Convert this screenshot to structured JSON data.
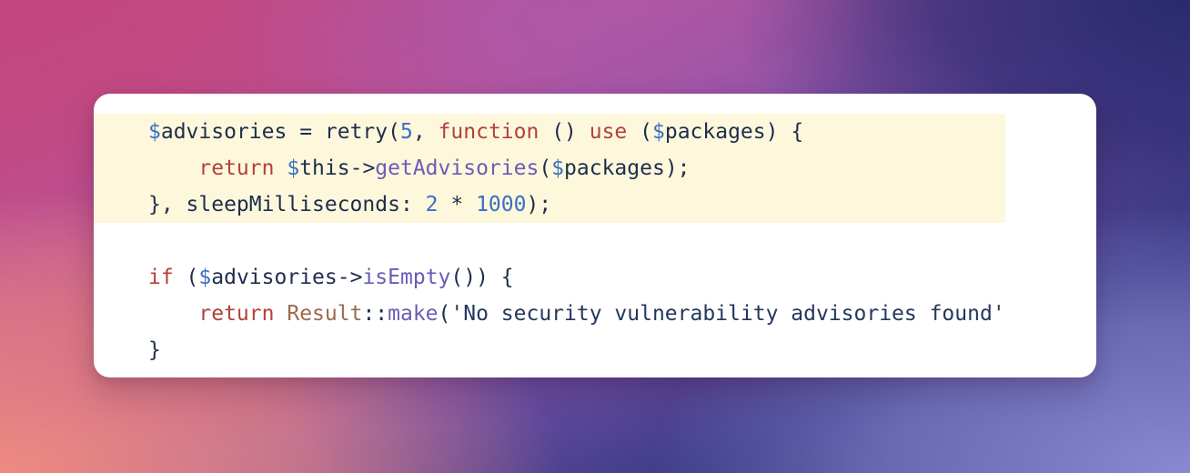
{
  "background": {
    "style": "mesh-gradient",
    "colors": {
      "top_left": "#c24a80",
      "top_mid": "#ac58aa",
      "top_right": "#2b2c6e",
      "bottom_left": "#ee8a80",
      "bottom_right": "#8a8ad2",
      "center": "#7a52ab"
    }
  },
  "card": {
    "background": "#ffffff",
    "highlight_background": "#fdf8dc",
    "corner_radius": "18px"
  },
  "syntax_colors": {
    "variable_sigil": "#3a6fc4",
    "identifier": "#1f2d4d",
    "keyword": "#b3413c",
    "number": "#3a6fc4",
    "method": "#6b5bb5",
    "class_name": "#9d6a4a",
    "string": "#25385c",
    "punctuation": "#1f2d4d"
  },
  "code": {
    "language": "php",
    "plain_text": "$advisories = retry(5, function () use ($packages) {\n    return $this->getAdvisories($packages);\n}, sleepMilliseconds: 2 * 1000);\n\nif ($advisories->isEmpty()) {\n    return Result::make('No security vulnerability advisories found'\n}",
    "lines": [
      {
        "index": 1,
        "highlighted": true,
        "tokens": [
          {
            "text": "$",
            "type": "var"
          },
          {
            "text": "advisories",
            "type": "name"
          },
          {
            "text": " = ",
            "type": "punct"
          },
          {
            "text": "retry",
            "type": "plain"
          },
          {
            "text": "(",
            "type": "punct"
          },
          {
            "text": "5",
            "type": "num"
          },
          {
            "text": ", ",
            "type": "punct"
          },
          {
            "text": "function",
            "type": "kw"
          },
          {
            "text": " () ",
            "type": "punct"
          },
          {
            "text": "use",
            "type": "kw"
          },
          {
            "text": " (",
            "type": "punct"
          },
          {
            "text": "$",
            "type": "var"
          },
          {
            "text": "packages",
            "type": "name"
          },
          {
            "text": ") {",
            "type": "punct"
          }
        ]
      },
      {
        "index": 2,
        "highlighted": true,
        "tokens": [
          {
            "text": "    ",
            "type": "plain"
          },
          {
            "text": "return",
            "type": "kw"
          },
          {
            "text": " ",
            "type": "plain"
          },
          {
            "text": "$",
            "type": "var"
          },
          {
            "text": "this",
            "type": "name"
          },
          {
            "text": "->",
            "type": "punct"
          },
          {
            "text": "getAdvisories",
            "type": "fn"
          },
          {
            "text": "(",
            "type": "punct"
          },
          {
            "text": "$",
            "type": "var"
          },
          {
            "text": "packages",
            "type": "name"
          },
          {
            "text": ");",
            "type": "punct"
          }
        ]
      },
      {
        "index": 3,
        "highlighted": true,
        "tokens": [
          {
            "text": "}, ",
            "type": "punct"
          },
          {
            "text": "sleepMilliseconds",
            "type": "plain"
          },
          {
            "text": ": ",
            "type": "punct"
          },
          {
            "text": "2",
            "type": "num"
          },
          {
            "text": " * ",
            "type": "punct"
          },
          {
            "text": "1000",
            "type": "num"
          },
          {
            "text": ");",
            "type": "punct"
          }
        ]
      },
      {
        "index": 4,
        "highlighted": false,
        "tokens": []
      },
      {
        "index": 5,
        "highlighted": false,
        "tokens": [
          {
            "text": "if",
            "type": "kw"
          },
          {
            "text": " (",
            "type": "punct"
          },
          {
            "text": "$",
            "type": "var"
          },
          {
            "text": "advisories",
            "type": "name"
          },
          {
            "text": "->",
            "type": "punct"
          },
          {
            "text": "isEmpty",
            "type": "fn"
          },
          {
            "text": "()) {",
            "type": "punct"
          }
        ]
      },
      {
        "index": 6,
        "highlighted": false,
        "tokens": [
          {
            "text": "    ",
            "type": "plain"
          },
          {
            "text": "return",
            "type": "kw"
          },
          {
            "text": " ",
            "type": "plain"
          },
          {
            "text": "Result",
            "type": "class"
          },
          {
            "text": "::",
            "type": "punct"
          },
          {
            "text": "make",
            "type": "fn"
          },
          {
            "text": "(",
            "type": "punct"
          },
          {
            "text": "'No security vulnerability advisories found'",
            "type": "str"
          }
        ]
      },
      {
        "index": 7,
        "highlighted": false,
        "tokens": [
          {
            "text": "}",
            "type": "punct"
          }
        ]
      }
    ]
  }
}
